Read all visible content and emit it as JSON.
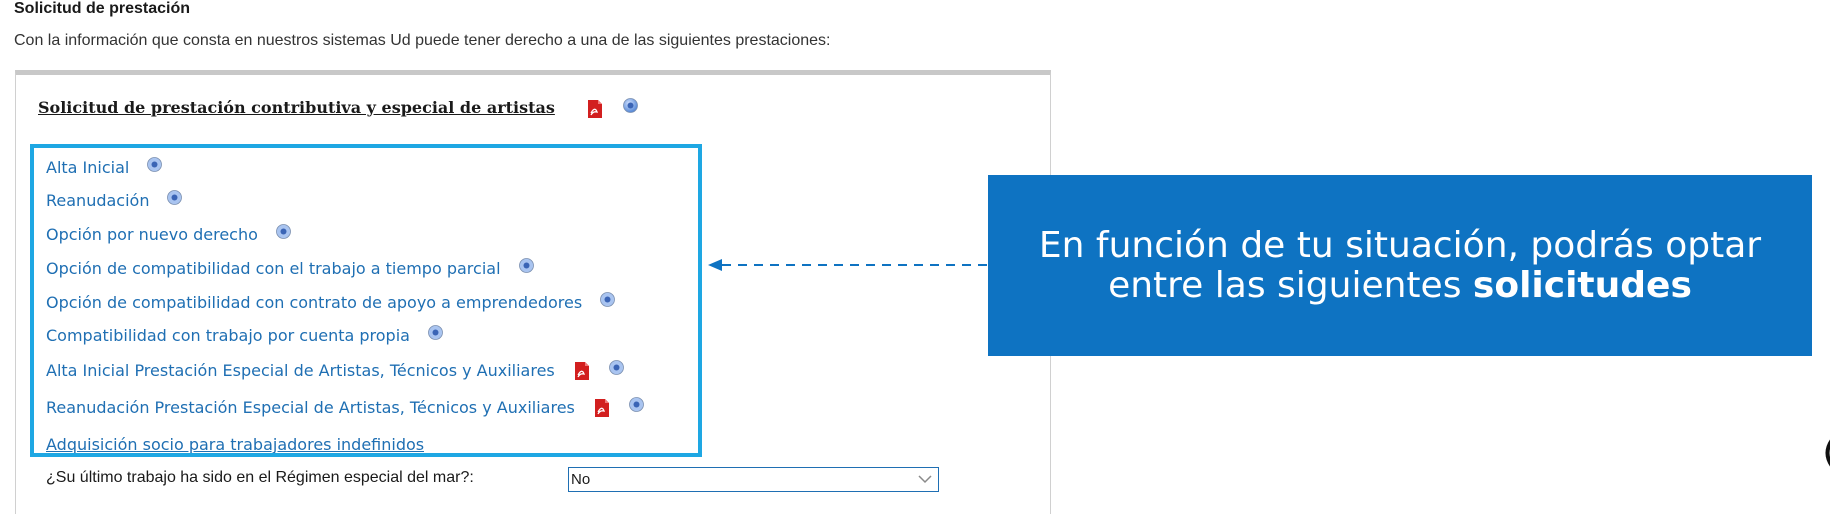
{
  "page": {
    "title": "Solicitud de prestación",
    "intro": "Con la información que consta en nuestros sistemas Ud puede tener derecho a una de las siguientes prestaciones:"
  },
  "section": {
    "heading": "Solicitud de prestación contributiva y especial de artistas"
  },
  "options": [
    {
      "label": "Alta Inicial",
      "pdf": false
    },
    {
      "label": "Reanudación",
      "pdf": false
    },
    {
      "label": "Opción por nuevo derecho",
      "pdf": false
    },
    {
      "label": "Opción de compatibilidad con el trabajo a tiempo parcial",
      "pdf": false
    },
    {
      "label": "Opción de compatibilidad con contrato de apoyo a emprendedores",
      "pdf": false
    },
    {
      "label": "Compatibilidad con trabajo por cuenta propia",
      "pdf": false
    },
    {
      "label": "Alta Inicial Prestación Especial de Artistas, Técnicos y Auxiliares",
      "pdf": true
    },
    {
      "label": "Reanudación Prestación Especial de Artistas, Técnicos y Auxiliares",
      "pdf": true
    },
    {
      "label": "Adquisición socio para trabajadores indefinidos",
      "pdf": false
    }
  ],
  "callout": {
    "line1": "En función de tu situación, podrás optar",
    "line2_prefix": "entre las siguientes ",
    "line2_bold": "solicitudes"
  },
  "question": {
    "label": "¿Su último trabajo ha sido en el Régimen especial del mar?:",
    "selected": "No"
  },
  "colors": {
    "link": "#1f6fb3",
    "highlight_border": "#1ea7e3",
    "callout_bg": "#0e73c2",
    "pdf_red": "#d21f1f",
    "help_blue": "#4a7fd1"
  },
  "icons": {
    "pdf": "pdf-icon",
    "help": "help-icon",
    "chevron": "chevron-down-icon"
  }
}
